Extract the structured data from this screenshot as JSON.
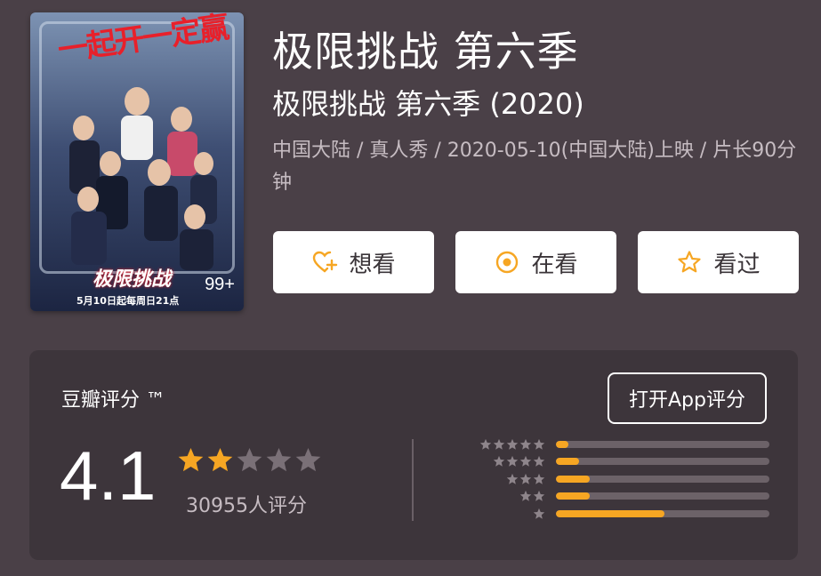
{
  "poster": {
    "top_text": "一起开一定赢",
    "logo_text": "极限挑战",
    "date_text": "5月10日起每周日21点",
    "badge": "99+"
  },
  "title": "极限挑战 第六季",
  "subtitle": "极限挑战 第六季 (2020)",
  "meta": "中国大陆 / 真人秀 / 2020-05-10(中国大陆)上映 / 片长90分钟",
  "actions": {
    "want": "想看",
    "watching": "在看",
    "watched": "看过"
  },
  "rating": {
    "title": "豆瓣评分 ™",
    "open_app": "打开App评分",
    "score": "4.1",
    "stars_filled": 2,
    "stars_total": 5,
    "count": "30955人评分",
    "distribution": [
      {
        "stars": 5,
        "fraction": 0.06
      },
      {
        "stars": 4,
        "fraction": 0.11
      },
      {
        "stars": 3,
        "fraction": 0.16
      },
      {
        "stars": 2,
        "fraction": 0.16
      },
      {
        "stars": 1,
        "fraction": 0.51
      }
    ]
  },
  "colors": {
    "background": "#4a4047",
    "card": "#3d353b",
    "accent": "#f6a623",
    "muted_text": "#c6bcc2"
  }
}
